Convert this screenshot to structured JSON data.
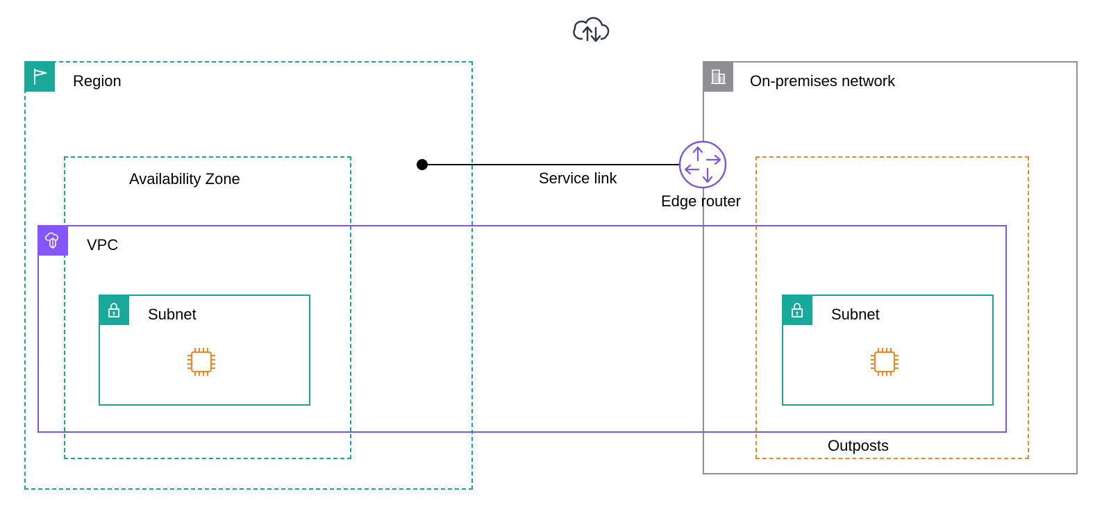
{
  "colors": {
    "teal": "#1ba397",
    "teal_fill": "#19a99b",
    "gray": "#8d8f92",
    "gray_fill": "#8d8f92",
    "purple": "#7e55d6",
    "purple_box": "#8555ff",
    "orange": "#e7892d",
    "darkgray_stroke": "#2e3846"
  },
  "labels": {
    "region": "Region",
    "az": "Availability Zone",
    "vpc": "VPC",
    "subnet_left": "Subnet",
    "subnet_right": "Subnet",
    "onprem": "On-premises network",
    "outposts": "Outposts",
    "service_link": "Service link",
    "edge_router": "Edge router"
  }
}
